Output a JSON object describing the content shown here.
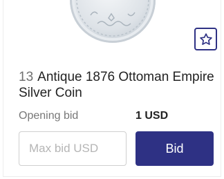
{
  "lot": {
    "number": "13",
    "title": "Antique 1876 Ottoman Empire Silver Coin",
    "image_icon": "coin-photo"
  },
  "watch": {
    "icon": "star-outline-icon"
  },
  "bid": {
    "opening_label": "Opening bid",
    "opening_value": "1 USD",
    "max_bid_placeholder": "Max bid USD",
    "max_bid_value": "",
    "button_label": "Bid"
  },
  "colors": {
    "accent": "#2e3184",
    "muted_text": "#777777",
    "border": "#cfcfcf"
  }
}
